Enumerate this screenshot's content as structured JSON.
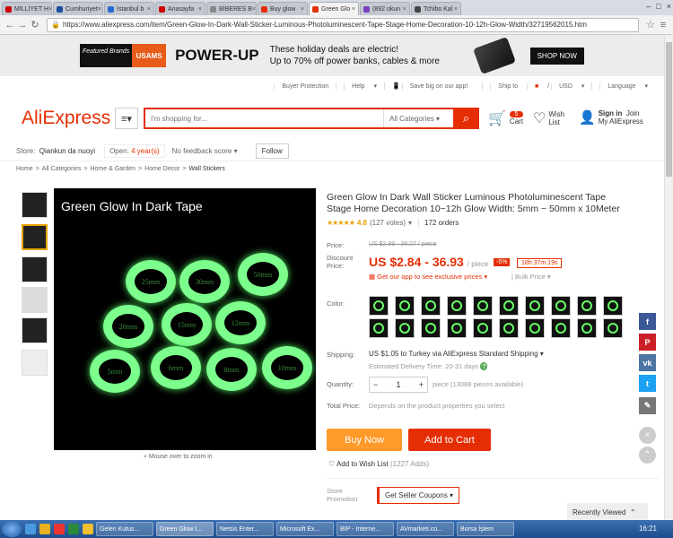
{
  "browser": {
    "tabs": [
      {
        "label": "MİLLİYET H",
        "color": "#c00"
      },
      {
        "label": "Cumhuriyet",
        "color": "#1a4f9c"
      },
      {
        "label": "İstanbul b",
        "color": "#2a6ad0"
      },
      {
        "label": "Anasayfa",
        "color": "#c00"
      },
      {
        "label": "BİBERES B",
        "color": "#888"
      },
      {
        "label": "Buy glow",
        "color": "#e62e04"
      },
      {
        "label": "Green Glo",
        "color": "#e62e04",
        "active": true
      },
      {
        "label": "(892 okun",
        "color": "#7a3fbf"
      },
      {
        "label": "Tchibo Kal",
        "color": "#444"
      }
    ],
    "url": "https://www.aliexpress.com/item/Green-Glow-In-Dark-Wall-Sticker-Luminous-Photoluminescent-Tape-Stage-Home-Decoration-10-12h-Glow-Width/32719562015.htm"
  },
  "promo": {
    "featured_brands": "Featured Brands",
    "brand": "USAMS",
    "headline": "POWER-UP",
    "line1": "These holiday deals are electric!",
    "line2": "Up to 70% off power banks, cables & more",
    "cta": "SHOP NOW"
  },
  "util": {
    "buyer_protection": "Buyer Protection",
    "help": "Help",
    "app": "Save big on our app!",
    "ship_to": "Ship to",
    "currency": "USD",
    "language": "Language"
  },
  "header": {
    "logo": "AliExpress",
    "search_placeholder": "I'm shopping for...",
    "all_categories": "All Categories",
    "cart_count": "5",
    "cart": "Cart",
    "wish": "Wish",
    "list": "List",
    "sign_in": "Sign in",
    "join": "Join",
    "my_ali": "My AliExpress"
  },
  "store": {
    "label": "Store:",
    "name": "Qiankun da nuoyi",
    "open_label": "Open:",
    "open_years": "4 year(s)",
    "feedback": "No feedback score",
    "follow": "Follow"
  },
  "breadcrumb": [
    "Home",
    ">",
    "All Categories",
    ">",
    "Home & Garden",
    ">",
    "Home Decor",
    ">",
    "Wall Stickers"
  ],
  "gallery": {
    "title": "Green Glow In Dark Tape",
    "ring_labels": [
      "25mm",
      "30mm",
      "50mm",
      "20mm",
      "15mm",
      "12mm",
      "5mm",
      "6mm",
      "8mm",
      "10mm"
    ],
    "zoom_hint": "Mouse over to zoom in"
  },
  "product": {
    "title": "Green Glow In Dark Wall Sticker Luminous Photoluminescent Tape Stage Home Decoration 10~12h Glow Width: 5mm ~ 50mm x 10Meter",
    "rating": "4.8",
    "votes": "(127 votes)",
    "orders": "172 orders",
    "price_label": "Price:",
    "old_price": "US $2.99 - 38.07 / piece",
    "discount_label": "Discount Price:",
    "price": "US $2.84 - 36.93",
    "per": "/ piece",
    "off": "-5%",
    "timer": "18h:37m:19s",
    "app_deal": "Get our app to see exclusive prices",
    "bulk": "Bulk Price",
    "color_label": "Color:",
    "shipping_label": "Shipping:",
    "shipping": "US $1.05 to Turkey via AliExpress Standard Shipping",
    "estimated": "Estimated Delivery Time: 20-31 days",
    "quantity_label": "Quantity:",
    "quantity": "1",
    "qty_info": "piece (13088 pieces available)",
    "total_label": "Total Price:",
    "total_note": "Depends on the product properties you select",
    "buy_now": "Buy Now",
    "add_to_cart": "Add to Cart",
    "wishlist": "Add to Wish List",
    "wish_count": "(1227 Adds)",
    "store_promo_label": "Store Promotion:",
    "coupons": "Get Seller Coupons"
  },
  "sidebar": {
    "recently_viewed": "Recently Viewed"
  },
  "taskbar": {
    "tasks": [
      "Gelen Kutus...",
      "Green Glow I...",
      "Netsis Enter...",
      "Microsoft Ex...",
      "BIP - Interne...",
      "AVmarketi.co...",
      "Borsa İşlem"
    ],
    "clock": "16:21"
  }
}
